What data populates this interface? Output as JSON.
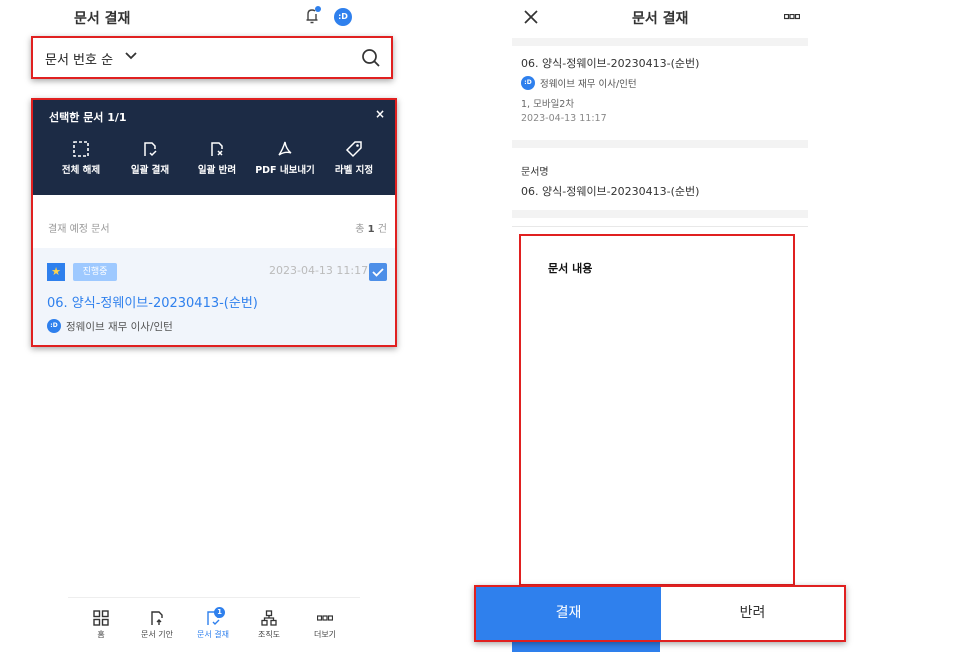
{
  "left": {
    "header": {
      "title": "문서 결재",
      "avatar": ":D"
    },
    "sort": {
      "label": "문서 번호 순"
    },
    "selection": {
      "title": "선택한 문서 1/1",
      "close": "×",
      "actions": [
        {
          "label": "전체 해제",
          "icon": "select-all-icon"
        },
        {
          "label": "일괄 결재",
          "icon": "approve-doc-icon"
        },
        {
          "label": "일괄 반려",
          "icon": "reject-doc-icon"
        },
        {
          "label": "PDF 내보내기",
          "icon": "pdf-icon"
        },
        {
          "label": "라벨 지정",
          "icon": "tag-icon"
        }
      ]
    },
    "section": {
      "label": "결재 예정 문서",
      "count_prefix": "총",
      "count": "1",
      "count_suffix": "건"
    },
    "doc": {
      "badge": "진행중",
      "date": "2023-04-13 11:17",
      "title": "06. 양식-정웨이브-20230413-(순번)",
      "avatar": ":D",
      "author": "정웨이브 재무 이사/인턴"
    },
    "nav": [
      {
        "label": "홈",
        "icon": "grid-icon"
      },
      {
        "label": "문서 기안",
        "icon": "draft-doc-icon"
      },
      {
        "label": "문서 결재",
        "icon": "approval-doc-icon",
        "badge": "1"
      },
      {
        "label": "조직도",
        "icon": "org-chart-icon"
      },
      {
        "label": "더보기",
        "icon": "more-icon"
      }
    ]
  },
  "right": {
    "header": {
      "title": "문서 결재"
    },
    "doc": {
      "title": "06. 양식-정웨이브-20230413-(순번)",
      "avatar": ":D",
      "author": "정웨이브 재무 이사/인턴",
      "step": "1, 모바일2차",
      "date": "2023-04-13 11:17"
    },
    "field": {
      "label": "문서명",
      "value": "06. 양식-정웨이브-20230413-(순번)"
    },
    "content": {
      "label": "문서 내용"
    },
    "actions": {
      "approve": "결재",
      "reject": "반려"
    }
  },
  "colors": {
    "accent": "#2f80ed",
    "header_bg": "#1c2b45",
    "highlight": "#e02020"
  }
}
